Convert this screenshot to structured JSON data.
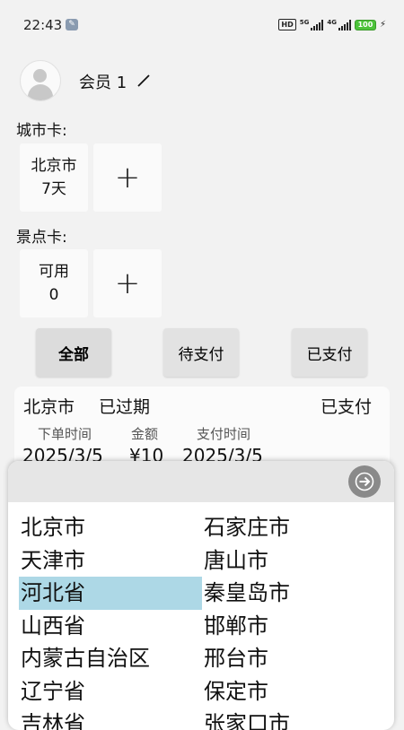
{
  "status": {
    "time": "22:43",
    "battery": "100",
    "net1": "5G",
    "net2": "4G",
    "hd": "HD"
  },
  "member": {
    "name": "会员 1"
  },
  "city_card": {
    "label": "城市卡:",
    "tile_city": "北京市",
    "tile_days": "7天",
    "add": "+"
  },
  "spot_card": {
    "label": "景点卡:",
    "tile_status": "可用",
    "tile_count": "0",
    "add": "+"
  },
  "filters": {
    "all": "全部",
    "pending": "待支付",
    "paid": "已支付"
  },
  "order": {
    "city": "北京市",
    "state": "已过期",
    "pay_status": "已支付",
    "h_time": "下单时间",
    "h_amount": "金额",
    "h_paytime": "支付时间",
    "v_time": "2025/3/5",
    "v_amount": "¥10",
    "v_paytime": "2025/3/5"
  },
  "picker": {
    "left": [
      "北京市",
      "天津市",
      "河北省",
      "山西省",
      "内蒙古自治区",
      "辽宁省",
      "吉林省"
    ],
    "right": [
      "石家庄市",
      "唐山市",
      "秦皇岛市",
      "邯郸市",
      "邢台市",
      "保定市",
      "张家口市"
    ],
    "selected_left_index": 2
  },
  "colors": {
    "selected": "#add8e6",
    "go_button": "#8a8a8a"
  }
}
